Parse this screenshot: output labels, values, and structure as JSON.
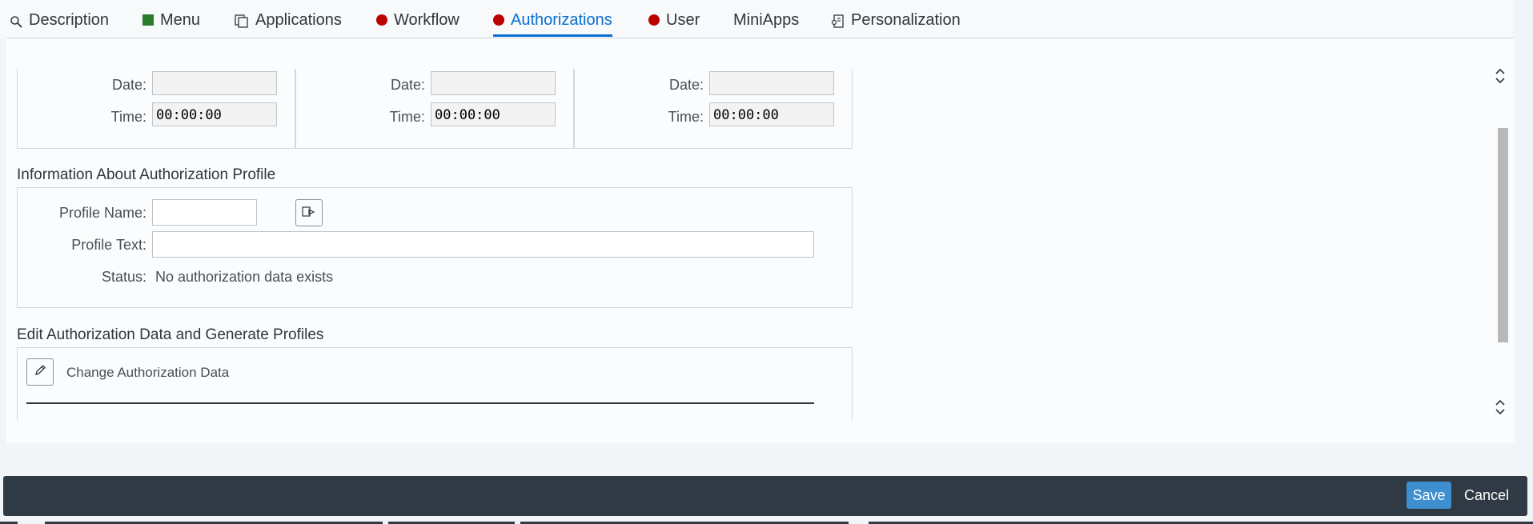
{
  "tabs": [
    {
      "label": "Description",
      "icon": "search-icon"
    },
    {
      "label": "Menu",
      "icon": "status-green-square-icon"
    },
    {
      "label": "Applications",
      "icon": "copy-icon"
    },
    {
      "label": "Workflow",
      "icon": "status-red-dot-icon"
    },
    {
      "label": "Authorizations",
      "icon": "status-red-dot-icon",
      "active": true
    },
    {
      "label": "User",
      "icon": "status-red-dot-icon"
    },
    {
      "label": "MiniApps",
      "icon": ""
    },
    {
      "label": "Personalization",
      "icon": "personalization-icon"
    }
  ],
  "validity": [
    {
      "date_label": "Date:",
      "date_value": "",
      "time_label": "Time:",
      "time_value": "00:00:00"
    },
    {
      "date_label": "Date:",
      "date_value": "",
      "time_label": "Time:",
      "time_value": "00:00:00"
    },
    {
      "date_label": "Date:",
      "date_value": "",
      "time_label": "Time:",
      "time_value": "00:00:00"
    }
  ],
  "profile_info": {
    "title": "Information About Authorization Profile",
    "profile_name_label": "Profile Name:",
    "profile_name_value": "",
    "profile_text_label": "Profile Text:",
    "profile_text_value": "",
    "status_label": "Status:",
    "status_value": "No authorization data exists"
  },
  "edit_section": {
    "title": "Edit Authorization Data and Generate Profiles",
    "change_button_label": "Change Authorization Data"
  },
  "footer": {
    "save_label": "Save",
    "cancel_label": "Cancel"
  },
  "colors": {
    "accent": "#0a6ed1",
    "status_red": "#bb0000",
    "status_green": "#2b7d2b",
    "footer_bg": "#2f3a45",
    "save_bg": "#3e8ed0"
  }
}
